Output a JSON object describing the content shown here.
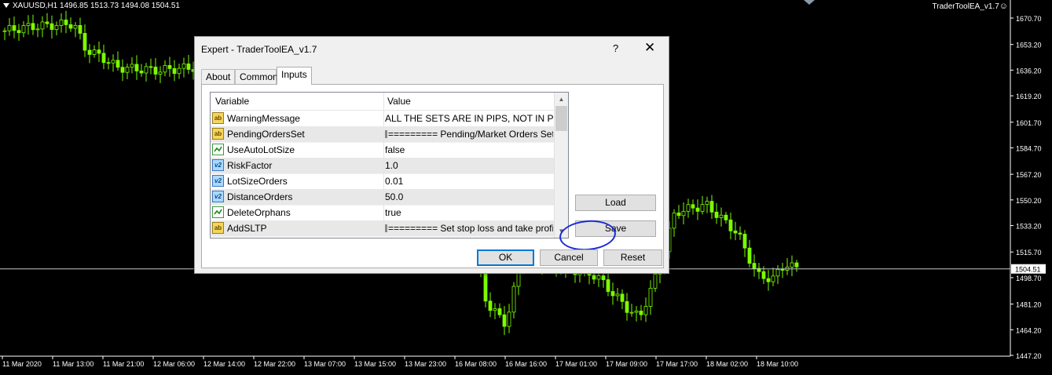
{
  "chart": {
    "symbol_line": "XAUUSD,H1  1496.85 1513.73 1494.08 1504.51",
    "ea_label": "TraderToolEA_v1.7",
    "ea_smile": "☺",
    "price_levels": [
      "1670.70",
      "1653.20",
      "1636.20",
      "1619.20",
      "1601.70",
      "1584.70",
      "1567.20",
      "1550.20",
      "1533.20",
      "1515.70",
      "1498.70",
      "1481.20",
      "1464.20",
      "1447.20"
    ],
    "current_price": "1504.51",
    "time_labels": [
      "11 Mar 2020",
      "11 Mar 13:00",
      "11 Mar 21:00",
      "12 Mar 06:00",
      "12 Mar 14:00",
      "12 Mar 22:00",
      "13 Mar 07:00",
      "13 Mar 15:00",
      "13 Mar 23:00",
      "16 Mar 08:00",
      "16 Mar 16:00",
      "17 Mar 01:00",
      "17 Mar 09:00",
      "17 Mar 17:00",
      "18 Mar 02:00",
      "18 Mar 10:00"
    ],
    "colors": {
      "background": "#000000",
      "candle": "#7CFC00",
      "text": "#ffffff"
    }
  },
  "dialog": {
    "title": "Expert - TraderToolEA_v1.7",
    "help": "?",
    "close": "✕",
    "tabs": [
      {
        "label": "About"
      },
      {
        "label": "Common"
      },
      {
        "label": "Inputs",
        "active": true
      }
    ],
    "grid": {
      "col_variable": "Variable",
      "col_value": "Value",
      "rows": [
        {
          "icon": "ab",
          "variable": "WarningMessage",
          "value": "ALL THE SETS ARE IN PIPS, NOT IN PO..."
        },
        {
          "icon": "ab",
          "variable": "PendingOrdersSet",
          "value": "========= Pending/Market Orders Sets ..."
        },
        {
          "icon": "bool",
          "variable": "UseAutoLotSize",
          "value": "false"
        },
        {
          "icon": "v2",
          "variable": "RiskFactor",
          "value": "1.0"
        },
        {
          "icon": "v2",
          "variable": "LotSizeOrders",
          "value": "0.01"
        },
        {
          "icon": "v2",
          "variable": "DistanceOrders",
          "value": "50.0"
        },
        {
          "icon": "bool",
          "variable": "DeleteOrphans",
          "value": "true"
        },
        {
          "icon": "ab",
          "variable": "AddSLTP",
          "value": "========= Set stop loss and take profit =..."
        }
      ]
    },
    "buttons": {
      "load": "Load",
      "save": "Save",
      "ok": "OK",
      "cancel": "Cancel",
      "reset": "Reset"
    }
  }
}
